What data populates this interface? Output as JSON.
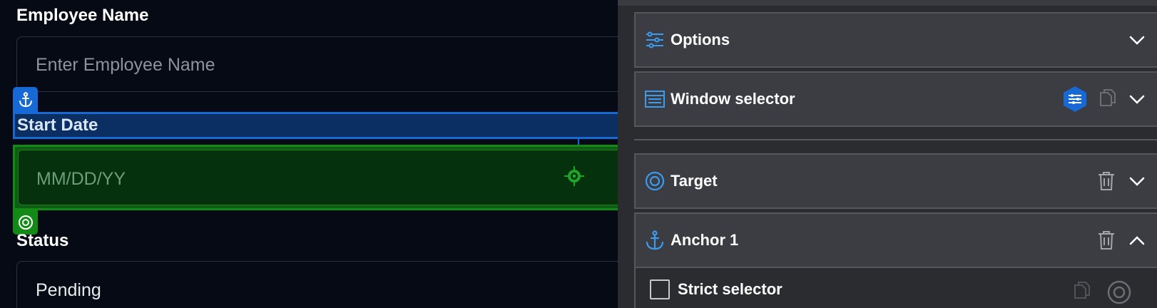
{
  "form": {
    "employee_name": {
      "label": "Employee Name",
      "placeholder": "Enter Employee Name"
    },
    "start_date": {
      "label": "Start Date",
      "placeholder": "MM/DD/YY"
    },
    "status": {
      "label": "Status",
      "value": "Pending"
    },
    "anchor_icon": "anchor-icon",
    "target_icon": "target-icon"
  },
  "panel": {
    "sections": {
      "options": {
        "title": "Options",
        "icon": "sliders-icon"
      },
      "window_selector": {
        "title": "Window selector",
        "icon": "window-icon"
      },
      "target": {
        "title": "Target",
        "icon": "target-icon"
      },
      "anchor": {
        "title": "Anchor",
        "count": "1",
        "icon": "anchor-icon"
      }
    },
    "strict_selector": {
      "label": "Strict selector",
      "checked": false
    }
  },
  "colors": {
    "accent_blue": "#1769d6",
    "target_green": "#138a16",
    "panel_bg": "#2b2c30",
    "section_bg": "#3b3d42",
    "form_bg": "#050a14"
  }
}
